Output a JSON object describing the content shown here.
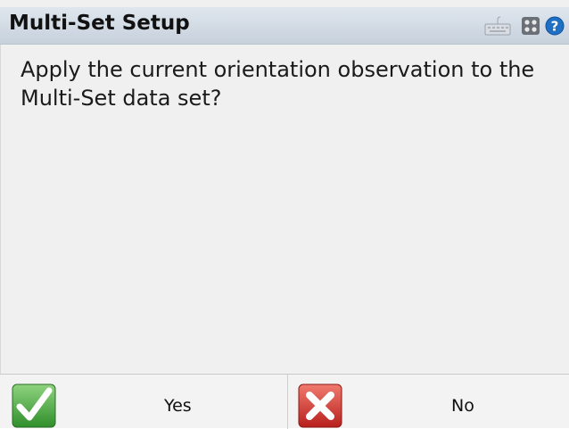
{
  "window": {
    "title": "Multi-Set Setup"
  },
  "titlebar_icons": [
    "keyboard-icon",
    "grid-icon",
    "help-icon"
  ],
  "message": "Apply the current orientation observation to the Multi-Set data set?",
  "buttons": {
    "yes_label": "Yes",
    "no_label": "No"
  },
  "colors": {
    "titlebar": "#c7d1dc",
    "background": "#f0f0f0",
    "help": "#1f6fc5",
    "yes_icon": "#3fa33a",
    "no_icon": "#d8322e"
  }
}
